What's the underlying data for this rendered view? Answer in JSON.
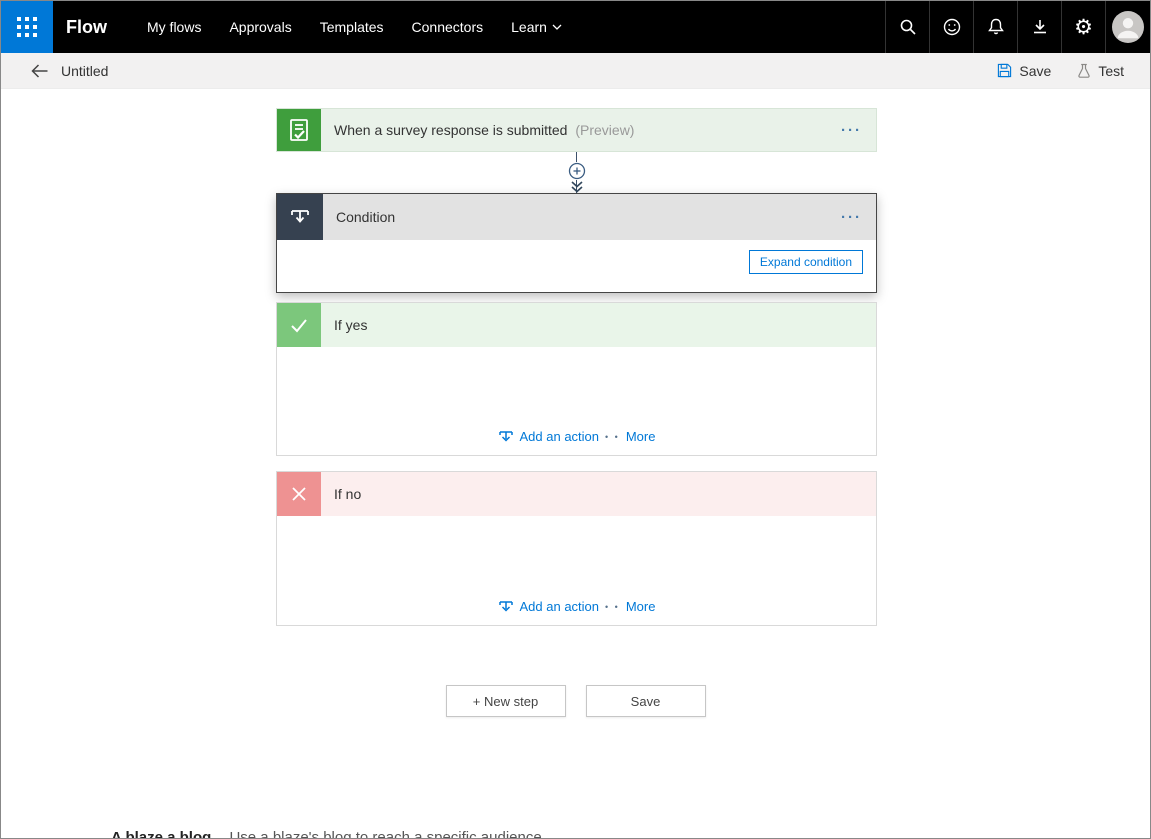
{
  "topnav": {
    "brand": "Flow",
    "items": [
      {
        "label": "My flows"
      },
      {
        "label": "Approvals"
      },
      {
        "label": "Templates"
      },
      {
        "label": "Connectors"
      },
      {
        "label": "Learn"
      }
    ]
  },
  "toolbar": {
    "title": "Untitled",
    "save_label": "Save",
    "test_label": "Test"
  },
  "canvas": {
    "trigger": {
      "title": "When a survey response is submitted",
      "preview_tag": "(Preview)",
      "menu_dots": "···"
    },
    "condition": {
      "title": "Condition",
      "menu_dots": "···",
      "expand_button": "Expand condition"
    },
    "branches": [
      {
        "title": "If yes",
        "add_action": "Add an action",
        "dots": "• •",
        "more": "More"
      },
      {
        "title": "If no",
        "add_action": "Add an action",
        "dots": "• •",
        "more": "More"
      }
    ],
    "footer": {
      "new_step": "+ New step",
      "save": "Save"
    }
  },
  "bottom_banner": {
    "title": "A blaze a blog",
    "description": "Use a blaze's blog to reach a specific audience."
  },
  "colors": {
    "accent_blue": "#0078d7",
    "nav_bg": "#000000",
    "waffle_blue": "#0078d7",
    "trigger_green": "#3f9e3d",
    "yes_green": "#7cc77c",
    "no_red": "#ee9292",
    "condition_dark": "#364150"
  }
}
